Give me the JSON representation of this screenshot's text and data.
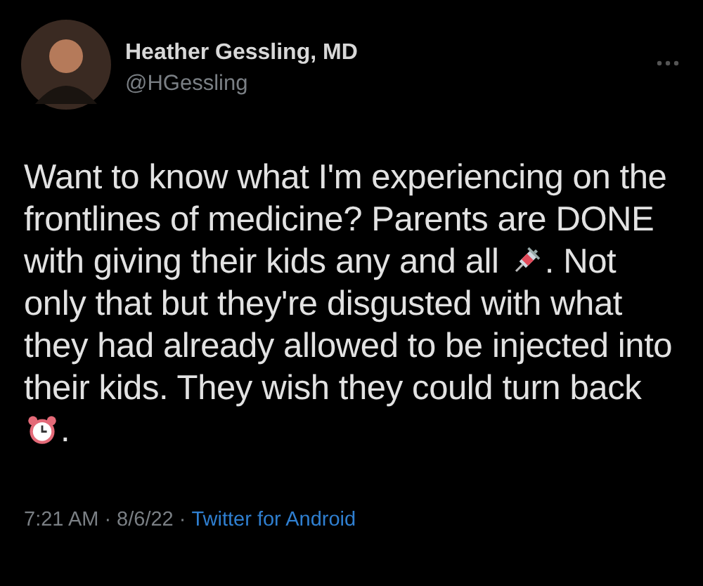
{
  "author": {
    "name": "Heather Gessling, MD",
    "handle": "@HGessling"
  },
  "body": [
    "Want to know what I'm experiencing on the frontlines of medicine? Parents are DONE with giving their kids any and all ",
    ". Not only that but they're disgusted with what they had already allowed to be injected into their kids. They wish they could turn back ",
    "."
  ],
  "footer": {
    "time": "7:21 AM",
    "separator": "·",
    "date": "8/6/22",
    "source": "Twitter for Android"
  }
}
